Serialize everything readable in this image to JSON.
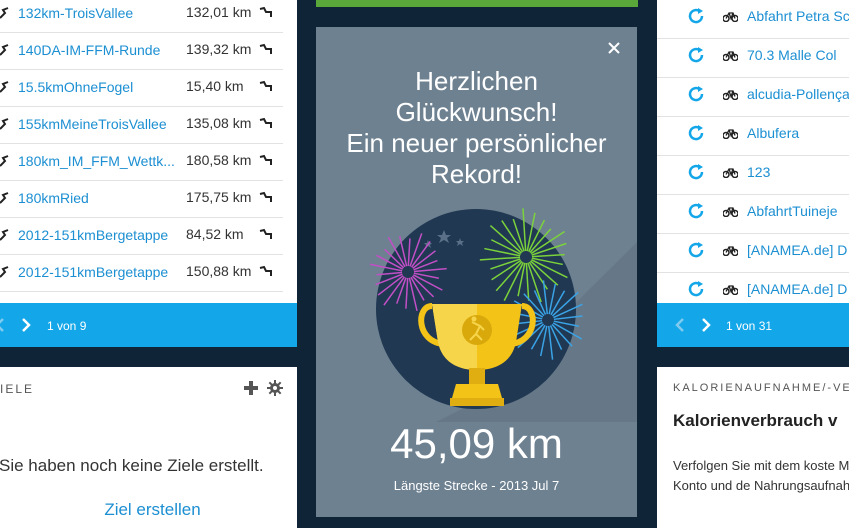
{
  "courses": {
    "rows": [
      {
        "name": "132km-TroisVallee",
        "distance": "132,01 km"
      },
      {
        "name": "140DA-IM-FFM-Runde",
        "distance": "139,32 km"
      },
      {
        "name": "15.5kmOhneFogel",
        "distance": "15,40 km"
      },
      {
        "name": "155kmMeineTroisVallee",
        "distance": "135,08 km"
      },
      {
        "name": "180km_IM_FFM_Wettk...",
        "distance": "180,58 km"
      },
      {
        "name": "180kmRied",
        "distance": "175,75 km"
      },
      {
        "name": "2012-151kmBergetappe",
        "distance": "84,52 km"
      },
      {
        "name": "2012-151kmBergetappe",
        "distance": "150,88 km"
      }
    ],
    "pager": "1 von 9"
  },
  "goals": {
    "title": "IELE",
    "empty_text": "Sie haben noch keine Ziele erstellt.",
    "create_link": "Ziel erstellen"
  },
  "modal": {
    "title_line1": "Herzlichen",
    "title_line2": "Glückwunsch!",
    "title_line3": "Ein neuer persönlicher",
    "title_line4": "Rekord!",
    "distance": "45,09 km",
    "subtitle": "Längste Strecke - 2013 Jul 7"
  },
  "activities": {
    "rows": [
      {
        "name": "Abfahrt Petra Sc"
      },
      {
        "name": "70.3 Malle Col"
      },
      {
        "name": "alcudia-Pollença"
      },
      {
        "name": "Albufera"
      },
      {
        "name": "123"
      },
      {
        "name": "AbfahrtTuineje"
      },
      {
        "name": "[ANAMEA.de] D"
      },
      {
        "name": "[ANAMEA.de] D"
      }
    ],
    "pager": "1 von 31"
  },
  "calories": {
    "title": "KALORIENAUFNAHME/-VE",
    "heading": "Kalorienverbrauch v",
    "body": "Verfolgen Sie mit dem koste MyFitnessPal-Konto und de Nahrungsaufnahme am Tag"
  },
  "colors": {
    "accent": "#13a6e8",
    "link": "#1c8fd2",
    "modal_bg": "#6e8191",
    "page_bg": "#0f2436",
    "trophy": "#f3c318"
  }
}
